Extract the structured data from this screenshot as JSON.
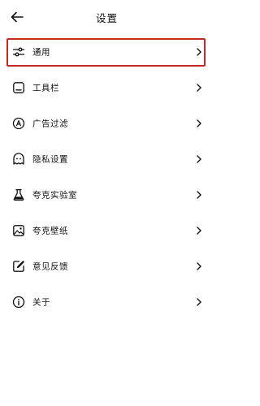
{
  "header": {
    "title": "设置"
  },
  "settings": {
    "items": [
      {
        "label": "通用",
        "icon": "sliders-icon",
        "selected": true
      },
      {
        "label": "工具栏",
        "icon": "toolbar-icon"
      },
      {
        "label": "广告过滤",
        "icon": "ad-block-icon"
      },
      {
        "label": "隐私设置",
        "icon": "privacy-ghost-icon"
      },
      {
        "label": "夸克实验室",
        "icon": "flask-icon"
      },
      {
        "label": "夸克壁纸",
        "icon": "wallpaper-icon"
      },
      {
        "label": "意见反馈",
        "icon": "feedback-edit-icon"
      },
      {
        "label": "关于",
        "icon": "info-icon"
      }
    ]
  },
  "colors": {
    "highlight": "#c62828",
    "text": "#111111",
    "background": "#ffffff"
  }
}
